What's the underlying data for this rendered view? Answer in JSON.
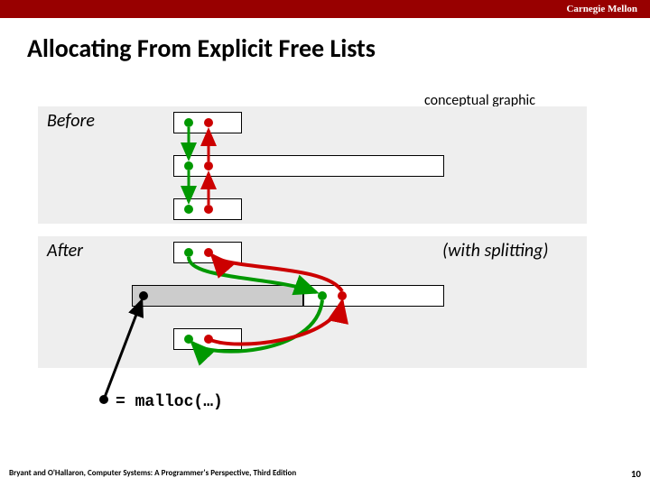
{
  "header": {
    "brand": "Carnegie Mellon"
  },
  "title": "Allocating From Explicit Free Lists",
  "note": "conceptual graphic",
  "labels": {
    "before": "Before",
    "after": "After",
    "split": "(with splitting)"
  },
  "legend": "= malloc(…)",
  "footer": {
    "citation": "Bryant and O'Hallaron, Computer Systems: A Programmer's Perspective, Third Edition",
    "page": "10"
  }
}
